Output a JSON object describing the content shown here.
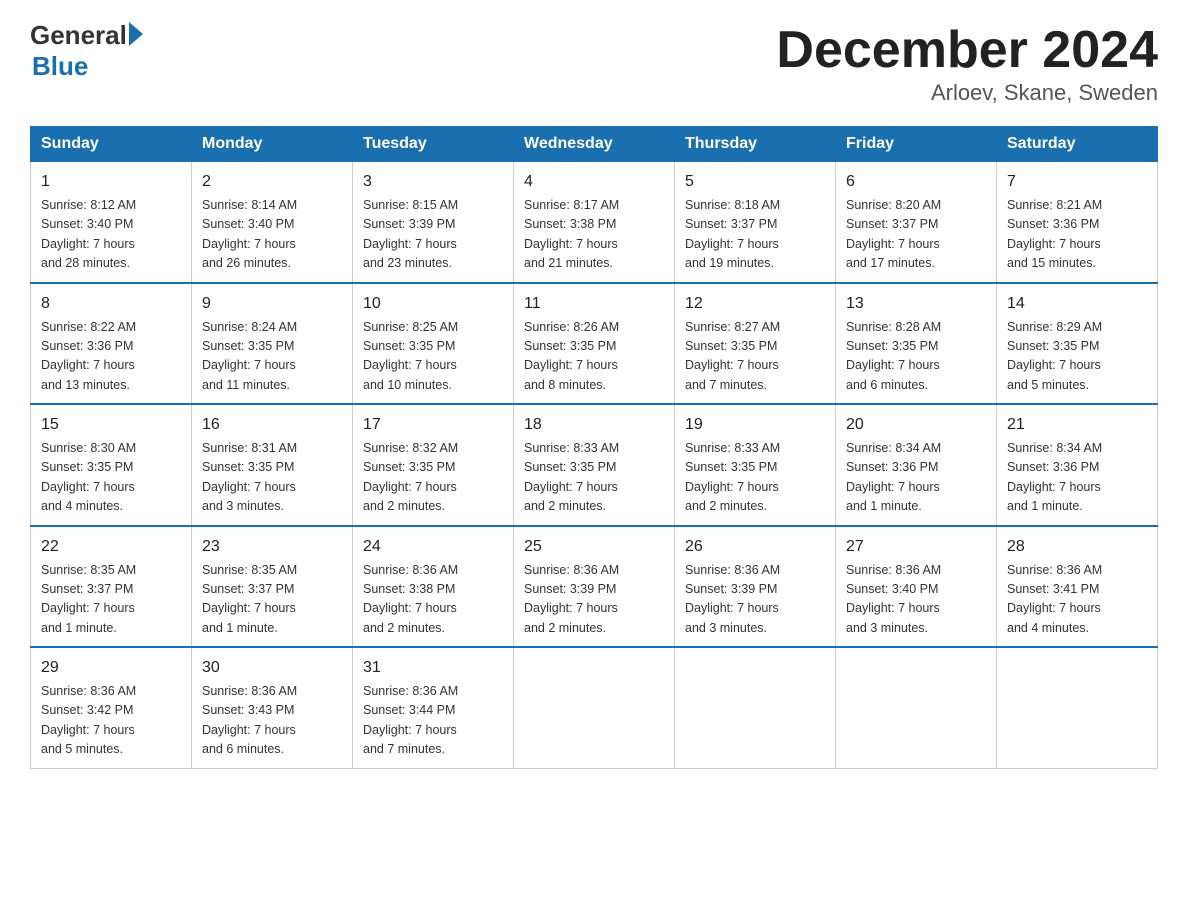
{
  "logo": {
    "general": "General",
    "blue": "Blue"
  },
  "title": "December 2024",
  "subtitle": "Arloev, Skane, Sweden",
  "days_header": [
    "Sunday",
    "Monday",
    "Tuesday",
    "Wednesday",
    "Thursday",
    "Friday",
    "Saturday"
  ],
  "weeks": [
    [
      {
        "day": "1",
        "info": "Sunrise: 8:12 AM\nSunset: 3:40 PM\nDaylight: 7 hours\nand 28 minutes."
      },
      {
        "day": "2",
        "info": "Sunrise: 8:14 AM\nSunset: 3:40 PM\nDaylight: 7 hours\nand 26 minutes."
      },
      {
        "day": "3",
        "info": "Sunrise: 8:15 AM\nSunset: 3:39 PM\nDaylight: 7 hours\nand 23 minutes."
      },
      {
        "day": "4",
        "info": "Sunrise: 8:17 AM\nSunset: 3:38 PM\nDaylight: 7 hours\nand 21 minutes."
      },
      {
        "day": "5",
        "info": "Sunrise: 8:18 AM\nSunset: 3:37 PM\nDaylight: 7 hours\nand 19 minutes."
      },
      {
        "day": "6",
        "info": "Sunrise: 8:20 AM\nSunset: 3:37 PM\nDaylight: 7 hours\nand 17 minutes."
      },
      {
        "day": "7",
        "info": "Sunrise: 8:21 AM\nSunset: 3:36 PM\nDaylight: 7 hours\nand 15 minutes."
      }
    ],
    [
      {
        "day": "8",
        "info": "Sunrise: 8:22 AM\nSunset: 3:36 PM\nDaylight: 7 hours\nand 13 minutes."
      },
      {
        "day": "9",
        "info": "Sunrise: 8:24 AM\nSunset: 3:35 PM\nDaylight: 7 hours\nand 11 minutes."
      },
      {
        "day": "10",
        "info": "Sunrise: 8:25 AM\nSunset: 3:35 PM\nDaylight: 7 hours\nand 10 minutes."
      },
      {
        "day": "11",
        "info": "Sunrise: 8:26 AM\nSunset: 3:35 PM\nDaylight: 7 hours\nand 8 minutes."
      },
      {
        "day": "12",
        "info": "Sunrise: 8:27 AM\nSunset: 3:35 PM\nDaylight: 7 hours\nand 7 minutes."
      },
      {
        "day": "13",
        "info": "Sunrise: 8:28 AM\nSunset: 3:35 PM\nDaylight: 7 hours\nand 6 minutes."
      },
      {
        "day": "14",
        "info": "Sunrise: 8:29 AM\nSunset: 3:35 PM\nDaylight: 7 hours\nand 5 minutes."
      }
    ],
    [
      {
        "day": "15",
        "info": "Sunrise: 8:30 AM\nSunset: 3:35 PM\nDaylight: 7 hours\nand 4 minutes."
      },
      {
        "day": "16",
        "info": "Sunrise: 8:31 AM\nSunset: 3:35 PM\nDaylight: 7 hours\nand 3 minutes."
      },
      {
        "day": "17",
        "info": "Sunrise: 8:32 AM\nSunset: 3:35 PM\nDaylight: 7 hours\nand 2 minutes."
      },
      {
        "day": "18",
        "info": "Sunrise: 8:33 AM\nSunset: 3:35 PM\nDaylight: 7 hours\nand 2 minutes."
      },
      {
        "day": "19",
        "info": "Sunrise: 8:33 AM\nSunset: 3:35 PM\nDaylight: 7 hours\nand 2 minutes."
      },
      {
        "day": "20",
        "info": "Sunrise: 8:34 AM\nSunset: 3:36 PM\nDaylight: 7 hours\nand 1 minute."
      },
      {
        "day": "21",
        "info": "Sunrise: 8:34 AM\nSunset: 3:36 PM\nDaylight: 7 hours\nand 1 minute."
      }
    ],
    [
      {
        "day": "22",
        "info": "Sunrise: 8:35 AM\nSunset: 3:37 PM\nDaylight: 7 hours\nand 1 minute."
      },
      {
        "day": "23",
        "info": "Sunrise: 8:35 AM\nSunset: 3:37 PM\nDaylight: 7 hours\nand 1 minute."
      },
      {
        "day": "24",
        "info": "Sunrise: 8:36 AM\nSunset: 3:38 PM\nDaylight: 7 hours\nand 2 minutes."
      },
      {
        "day": "25",
        "info": "Sunrise: 8:36 AM\nSunset: 3:39 PM\nDaylight: 7 hours\nand 2 minutes."
      },
      {
        "day": "26",
        "info": "Sunrise: 8:36 AM\nSunset: 3:39 PM\nDaylight: 7 hours\nand 3 minutes."
      },
      {
        "day": "27",
        "info": "Sunrise: 8:36 AM\nSunset: 3:40 PM\nDaylight: 7 hours\nand 3 minutes."
      },
      {
        "day": "28",
        "info": "Sunrise: 8:36 AM\nSunset: 3:41 PM\nDaylight: 7 hours\nand 4 minutes."
      }
    ],
    [
      {
        "day": "29",
        "info": "Sunrise: 8:36 AM\nSunset: 3:42 PM\nDaylight: 7 hours\nand 5 minutes."
      },
      {
        "day": "30",
        "info": "Sunrise: 8:36 AM\nSunset: 3:43 PM\nDaylight: 7 hours\nand 6 minutes."
      },
      {
        "day": "31",
        "info": "Sunrise: 8:36 AM\nSunset: 3:44 PM\nDaylight: 7 hours\nand 7 minutes."
      },
      null,
      null,
      null,
      null
    ]
  ]
}
